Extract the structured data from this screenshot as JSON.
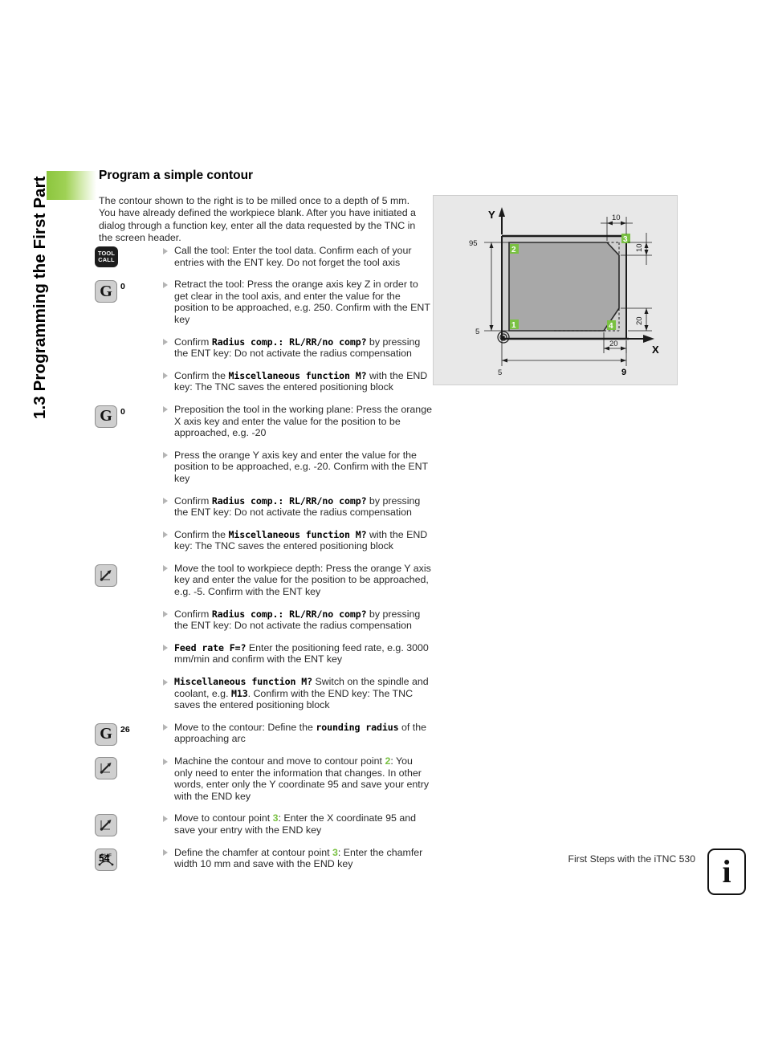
{
  "side_tab": {
    "label": "1.3 Programming the First Part",
    "accent_color": "#8cc63e"
  },
  "heading": "Program a simple contour",
  "intro": "The contour shown to the right is to be milled once to a depth of 5 mm. You have already defined the workpiece blank. After you have initiated a dialog through a function key, enter all the data requested by the TNC in the screen header.",
  "keys": {
    "tool_call_line1": "TOOL",
    "tool_call_line2": "CALL",
    "g_letter": "G",
    "g0_sub": "0",
    "g26_sub": "26",
    "chf_label": "CHF"
  },
  "steps": [
    {
      "key": "tool-call",
      "bullets": [
        {
          "parts": [
            {
              "t": "Call the tool: Enter the tool data. Confirm each of your entries with the ENT key. Do not forget the tool axis",
              "s": "normal"
            }
          ]
        }
      ]
    },
    {
      "key": "g-0-a",
      "bullets": [
        {
          "parts": [
            {
              "t": "Retract the tool: Press the orange axis key Z in order to get clear in the tool axis, and enter the value for the position to be approached, e.g. 250. Confirm with the ENT key",
              "s": "normal"
            }
          ]
        },
        {
          "parts": [
            {
              "t": "Confirm ",
              "s": "normal"
            },
            {
              "t": "Radius comp.: RL/RR/no comp?",
              "s": "mono"
            },
            {
              "t": " by pressing the ENT key: Do not activate the radius compensation",
              "s": "normal"
            }
          ]
        },
        {
          "parts": [
            {
              "t": "Confirm the ",
              "s": "normal"
            },
            {
              "t": "Miscellaneous function M?",
              "s": "mono"
            },
            {
              "t": " with the END key: The TNC saves the entered positioning block",
              "s": "normal"
            }
          ]
        }
      ]
    },
    {
      "key": "g-0-b",
      "bullets": [
        {
          "parts": [
            {
              "t": "Preposition the tool in the working plane: Press the orange X axis key and enter the value for the position to be approached, e.g. -20",
              "s": "normal"
            }
          ]
        },
        {
          "parts": [
            {
              "t": "Press the orange Y axis key and enter the value for the position to be approached, e.g. -20. Confirm with the ENT key",
              "s": "normal"
            }
          ]
        },
        {
          "parts": [
            {
              "t": "Confirm ",
              "s": "normal"
            },
            {
              "t": "Radius comp.: RL/RR/no comp?",
              "s": "mono"
            },
            {
              "t": " by pressing the ENT key: Do not activate the radius compensation",
              "s": "normal"
            }
          ]
        },
        {
          "parts": [
            {
              "t": "Confirm the ",
              "s": "normal"
            },
            {
              "t": "Miscellaneous function M?",
              "s": "mono"
            },
            {
              "t": " with the END key: The TNC saves the entered positioning block",
              "s": "normal"
            }
          ]
        }
      ]
    },
    {
      "key": "line-a",
      "bullets": [
        {
          "parts": [
            {
              "t": "Move the tool to workpiece depth: Press the orange Y axis key and enter the value for the position to be approached, e.g. -5. Confirm with the ENT key",
              "s": "normal"
            }
          ]
        },
        {
          "parts": [
            {
              "t": "Confirm ",
              "s": "normal"
            },
            {
              "t": "Radius comp.: RL/RR/no comp?",
              "s": "mono"
            },
            {
              "t": " by pressing the ENT key: Do not activate the radius compensation",
              "s": "normal"
            }
          ]
        },
        {
          "parts": [
            {
              "t": "Feed rate F=?",
              "s": "mono"
            },
            {
              "t": " Enter the positioning feed rate, e.g. 3000 mm/min and confirm with the ENT key",
              "s": "normal"
            }
          ]
        },
        {
          "parts": [
            {
              "t": "Miscellaneous function M?",
              "s": "mono"
            },
            {
              "t": " Switch on the spindle and coolant, e.g. ",
              "s": "normal"
            },
            {
              "t": "M13",
              "s": "mono"
            },
            {
              "t": ". Confirm with the END key: The TNC saves the entered positioning block",
              "s": "normal"
            }
          ]
        }
      ]
    },
    {
      "key": "g-26",
      "bullets": [
        {
          "parts": [
            {
              "t": "Move to the contour: Define the ",
              "s": "normal"
            },
            {
              "t": "rounding radius",
              "s": "mono"
            },
            {
              "t": " of the approaching arc",
              "s": "normal"
            }
          ]
        }
      ]
    },
    {
      "key": "line-b",
      "bullets": [
        {
          "parts": [
            {
              "t": "Machine the contour and move to contour point ",
              "s": "normal"
            },
            {
              "t": "2",
              "s": "green"
            },
            {
              "t": ": You only need to enter the information that changes. In other words, enter only the Y coordinate 95 and save your entry with the END key",
              "s": "normal"
            }
          ]
        }
      ]
    },
    {
      "key": "line-c",
      "bullets": [
        {
          "parts": [
            {
              "t": "Move to contour point ",
              "s": "normal"
            },
            {
              "t": "3",
              "s": "green"
            },
            {
              "t": ": Enter the X coordinate 95 and save your entry with the END key",
              "s": "normal"
            }
          ]
        }
      ]
    },
    {
      "key": "chf",
      "bullets": [
        {
          "parts": [
            {
              "t": "Define the chamfer at contour point ",
              "s": "normal"
            },
            {
              "t": "3",
              "s": "green"
            },
            {
              "t": ": Enter the chamfer width 10 mm and save with the END key",
              "s": "normal"
            }
          ]
        }
      ]
    }
  ],
  "drawing": {
    "axis_x_label": "X",
    "axis_y_label": "Y",
    "point_labels": [
      "1",
      "2",
      "3",
      "4"
    ],
    "point_color": "#7ac143",
    "dimensions": {
      "left_upper": "95",
      "left_lower": "5",
      "bottom_left": "5",
      "bottom_right": "9",
      "bottom_inner": "20",
      "top_chamfer_width": "10",
      "right_upper_chamfer": "10",
      "right_lower_chamfer": "20"
    }
  },
  "footer": {
    "page_number": "54",
    "title": "First Steps with the iTNC 530",
    "info_icon_glyph": "i"
  }
}
